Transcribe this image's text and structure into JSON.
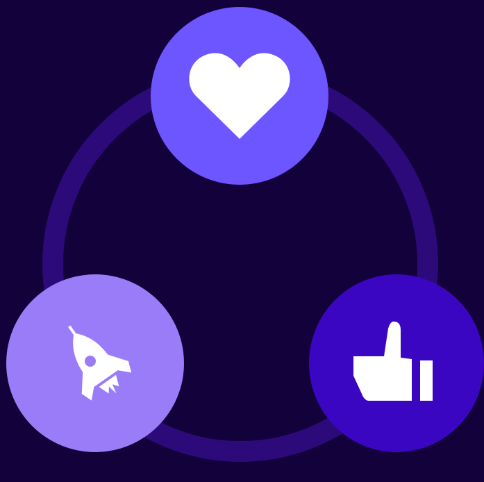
{
  "colors": {
    "background": "#12013a",
    "ring": "#2c0a7a",
    "heart_node": "#6d55ff",
    "rocket_node": "#9b7cf8",
    "thumbs_node": "#3b06c2",
    "icon": "#ffffff"
  },
  "nodes": [
    {
      "id": "heart",
      "icon": "heart-icon"
    },
    {
      "id": "rocket",
      "icon": "rocket-icon"
    },
    {
      "id": "thumbs-up",
      "icon": "thumbs-up-icon"
    }
  ]
}
